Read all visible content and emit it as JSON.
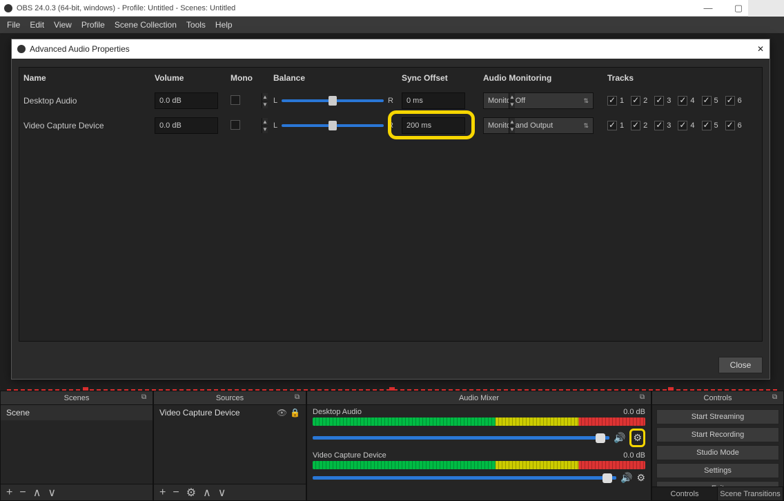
{
  "window": {
    "title": "OBS 24.0.3 (64-bit, windows) - Profile: Untitled - Scenes: Untitled"
  },
  "menu": [
    "File",
    "Edit",
    "View",
    "Profile",
    "Scene Collection",
    "Tools",
    "Help"
  ],
  "dialog": {
    "title": "Advanced Audio Properties",
    "close_button": "Close",
    "headers": {
      "name": "Name",
      "volume": "Volume",
      "mono": "Mono",
      "balance": "Balance",
      "sync": "Sync Offset",
      "monitoring": "Audio Monitoring",
      "tracks": "Tracks"
    },
    "balance_labels": {
      "left": "L",
      "right": "R"
    },
    "track_labels": [
      "1",
      "2",
      "3",
      "4",
      "5",
      "6"
    ],
    "rows": [
      {
        "name": "Desktop Audio",
        "volume": "0.0 dB",
        "mono": false,
        "sync": "0 ms",
        "monitoring": "Monitor Off",
        "tracks": [
          true,
          true,
          true,
          true,
          true,
          true
        ],
        "highlight_sync": false
      },
      {
        "name": "Video Capture Device",
        "volume": "0.0 dB",
        "mono": false,
        "sync": "200 ms",
        "monitoring": "Monitor and Output",
        "tracks": [
          true,
          true,
          true,
          true,
          true,
          true
        ],
        "highlight_sync": true
      }
    ]
  },
  "panels": {
    "scenes": {
      "title": "Scenes",
      "items": [
        "Scene"
      ]
    },
    "sources": {
      "title": "Sources",
      "items": [
        "Video Capture Device"
      ]
    },
    "mixer": {
      "title": "Audio Mixer",
      "strips": [
        {
          "name": "Desktop Audio",
          "db": "0.0 dB",
          "highlight_gear": true
        },
        {
          "name": "Video Capture Device",
          "db": "0.0 dB",
          "highlight_gear": false
        }
      ]
    },
    "controls": {
      "title": "Controls",
      "buttons": [
        "Start Streaming",
        "Start Recording",
        "Studio Mode",
        "Settings",
        "Exit"
      ],
      "tabs": [
        "Controls",
        "Scene Transitions"
      ]
    }
  }
}
